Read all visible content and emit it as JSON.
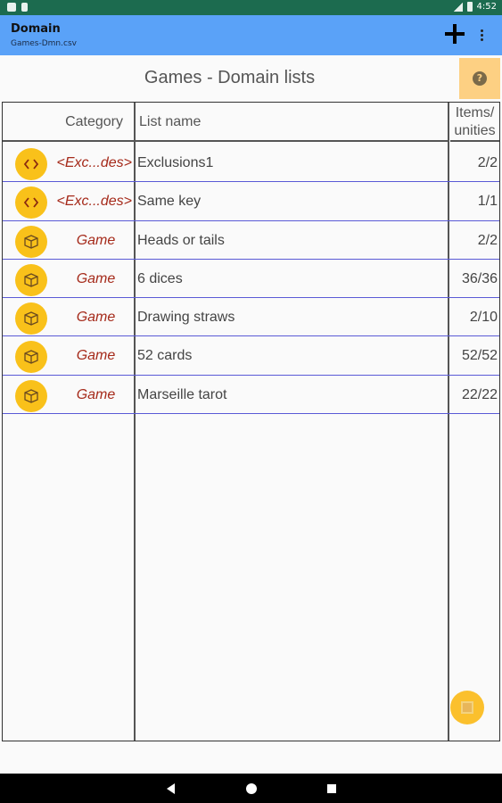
{
  "status_bar": {
    "time": "4:52"
  },
  "appbar": {
    "title": "Domain",
    "subtitle": "Games-Dmn.csv",
    "add_icon": "plus-icon",
    "more_icon": "more-vert-icon"
  },
  "page": {
    "title": "Games - Domain lists",
    "help_icon": "help-icon"
  },
  "table": {
    "headers": {
      "category": "Category",
      "list_name": "List name",
      "items_line1": "Items/",
      "items_line2": "unities"
    },
    "rows": [
      {
        "icon": "code-brackets-icon",
        "category": "<Exc...des>",
        "name": "Exclusions1",
        "count": "2/2"
      },
      {
        "icon": "code-brackets-icon",
        "category": "<Exc...des>",
        "name": "Same key",
        "count": "1/1"
      },
      {
        "icon": "dice-icon",
        "category": "Game",
        "name": "Heads or tails",
        "count": "2/2"
      },
      {
        "icon": "dice-icon",
        "category": "Game",
        "name": "6 dices",
        "count": "36/36"
      },
      {
        "icon": "dice-icon",
        "category": "Game",
        "name": "Drawing straws",
        "count": "2/10"
      },
      {
        "icon": "dice-icon",
        "category": "Game",
        "name": "52 cards",
        "count": "52/52"
      },
      {
        "icon": "dice-icon",
        "category": "Game",
        "name": "Marseille tarot",
        "count": "22/22"
      }
    ]
  },
  "colors": {
    "appbar": "#5aa2f8",
    "status_bar": "#1c6b4f",
    "accent": "#f9c11a",
    "category_text": "#a52a1a",
    "row_divider": "#5a5ad6"
  },
  "fab": {
    "icon": "save-icon"
  }
}
